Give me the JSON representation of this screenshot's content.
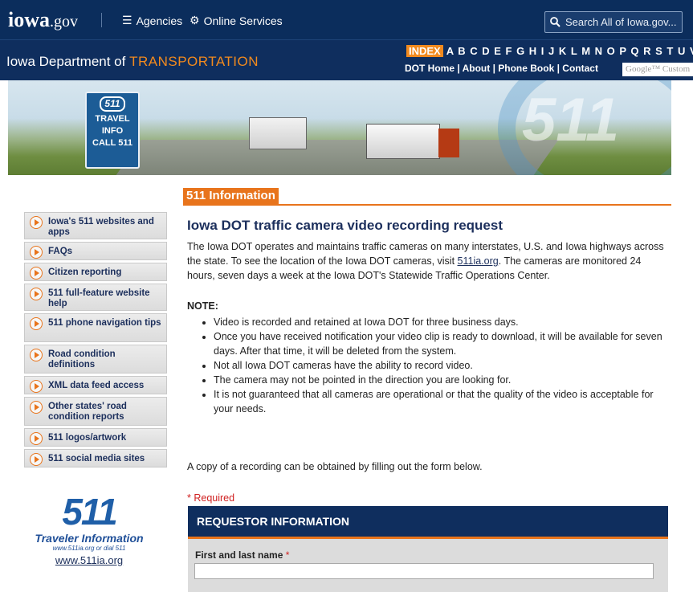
{
  "topbar": {
    "logo_main": "iowa",
    "logo_suffix": ".gov",
    "agencies_label": "Agencies",
    "services_label": "Online Services",
    "search_placeholder": "Search All of Iowa.gov..."
  },
  "dept": {
    "name_prefix": "Iowa Department of ",
    "name_highlight": "TRANSPORTATION",
    "index_label": "INDEX",
    "index_letters": "A B C D E F G H I J K L M N O P Q R S T U V W X",
    "nav": "DOT Home | About | Phone Book | Contact",
    "google_text": "Google™ Custom"
  },
  "banner": {
    "sign_badge": "511",
    "sign_line1": "TRAVEL",
    "sign_line2": "INFO",
    "sign_line3": "CALL 511",
    "big_text": "511"
  },
  "section_title": "511 Information",
  "sidebar": {
    "items": [
      {
        "label": "Iowa's 511 websites and apps"
      },
      {
        "label": "FAQs"
      },
      {
        "label": "Citizen reporting"
      },
      {
        "label": "511 full-feature website help"
      },
      {
        "label": "511 phone navigation tips"
      },
      {
        "label": "Road condition definitions"
      },
      {
        "label": "XML data feed access"
      },
      {
        "label": "Other states' road condition reports"
      },
      {
        "label": "511 logos/artwork"
      },
      {
        "label": "511 social media sites"
      }
    ]
  },
  "logo511": {
    "mark": "511",
    "title": "Traveler Information",
    "tagline": "www.511ia.org or dial 511",
    "url": "www.511ia.org"
  },
  "main": {
    "title": "Iowa DOT traffic camera video recording request",
    "intro_before": "The Iowa DOT operates and maintains traffic cameras on many interstates, U.S. and Iowa highways across the state. To see the location of the Iowa DOT cameras, visit ",
    "intro_link": "511ia.org",
    "intro_after": ". The cameras are monitored 24 hours, seven days a week at the Iowa DOT's Statewide Traffic Operations Center.",
    "note_label": "NOTE:",
    "notes": [
      "Video is recorded and retained at Iowa DOT for three business days.",
      "Once you have received notification your video clip is ready to download, it will be available for seven days. After that time, it will be deleted from the system.",
      "Not all Iowa DOT cameras have the ability to record video.",
      "The camera may not be pointed in the direction you are looking for.",
      "It is not guaranteed that all cameras are operational or that the quality of the video is acceptable for your needs."
    ],
    "copy_text": "A copy of a recording can be obtained by filling out the form below.",
    "required_text": "* Required"
  },
  "form": {
    "header": "REQUESTOR INFORMATION",
    "name_label": "First and last name",
    "name_star": "*",
    "name_value": ""
  }
}
